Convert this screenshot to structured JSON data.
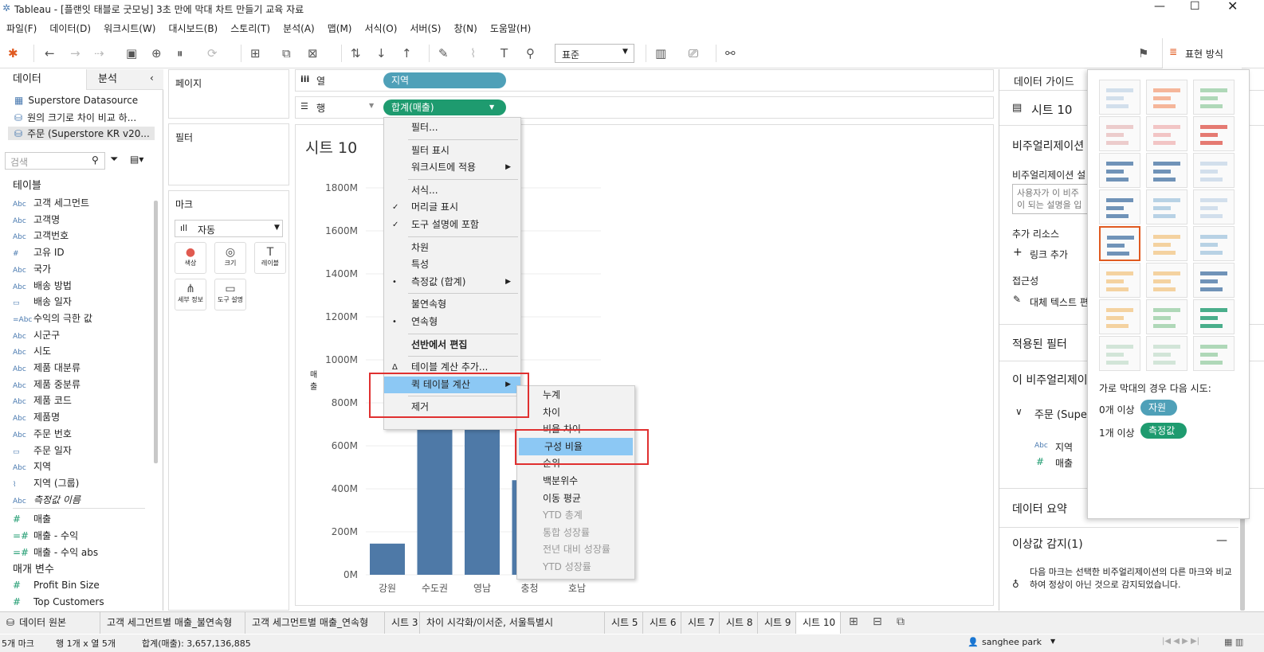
{
  "window": {
    "title": "Tableau - [플랜잇 태블로 굿모닝] 3초 만에 막대 차트 만들기 교육 자료"
  },
  "menubar": [
    "파일(F)",
    "데이터(D)",
    "워크시트(W)",
    "대시보드(B)",
    "스토리(T)",
    "분석(A)",
    "맵(M)",
    "서식(O)",
    "서버(S)",
    "창(N)",
    "도움말(H)"
  ],
  "toolbar": {
    "fit_value": "표준",
    "show_me_label": "표현 방식"
  },
  "left": {
    "tab_data": "데이터",
    "tab_analysis": "분석",
    "datasources": [
      "Superstore Datasource",
      "원의 크기로 차이 비교 하...",
      "주문 (Superstore KR v20..."
    ],
    "search_placeholder": "검색",
    "tables_header": "테이블",
    "dimensions": [
      {
        "type": "Abc",
        "name": "고객 세그먼트"
      },
      {
        "type": "Abc",
        "name": "고객명"
      },
      {
        "type": "Abc",
        "name": "고객번호"
      },
      {
        "type": "#",
        "name": "고유 ID"
      },
      {
        "type": "Abc",
        "name": "국가"
      },
      {
        "type": "Abc",
        "name": "배송 방법"
      },
      {
        "type": "date",
        "name": "배송 일자"
      },
      {
        "type": "=Abc",
        "name": "수익의 극한 값"
      },
      {
        "type": "Abc",
        "name": "시군구"
      },
      {
        "type": "Abc",
        "name": "시도"
      },
      {
        "type": "Abc",
        "name": "제품 대분류"
      },
      {
        "type": "Abc",
        "name": "제품 중분류"
      },
      {
        "type": "Abc",
        "name": "제품 코드"
      },
      {
        "type": "Abc",
        "name": "제품명"
      },
      {
        "type": "Abc",
        "name": "주문 번호"
      },
      {
        "type": "date",
        "name": "주문 일자"
      },
      {
        "type": "Abc",
        "name": "지역"
      },
      {
        "type": "clip",
        "name": "지역 (그룹)"
      },
      {
        "type": "Abc",
        "name": "측정값 이름"
      }
    ],
    "measures": [
      {
        "type": "#",
        "name": "매출"
      },
      {
        "type": "=#",
        "name": "매출 - 수익"
      },
      {
        "type": "=#",
        "name": "매출 - 수익 abs"
      }
    ],
    "params_header": "매개 변수",
    "params": [
      "Profit Bin Size",
      "Top Customers"
    ]
  },
  "cards": {
    "pages": "페이지",
    "filters": "필터",
    "marks": "마크",
    "mark_type": "자동",
    "mark_buttons": [
      "색상",
      "크기",
      "레이블",
      "세부 정보",
      "도구 설명"
    ]
  },
  "shelves": {
    "columns_label": "열",
    "rows_label": "행",
    "columns_pill": "지역",
    "rows_pill": "합계(매출)"
  },
  "sheet": {
    "title": "시트 10",
    "axis_label": "매출"
  },
  "chart_data": {
    "type": "bar",
    "categories": [
      "강원",
      "수도권",
      "영남",
      "충청",
      "호남"
    ],
    "values": [
      145000000,
      1500000000,
      1200000000,
      440000000,
      380000000
    ],
    "ylim": [
      0,
      1800000000
    ],
    "yticks": [
      "0M",
      "200M",
      "400M",
      "600M",
      "800M",
      "1000M",
      "1200M",
      "1400M",
      "1600M",
      "1800M"
    ],
    "color": "#4e79a7"
  },
  "context_menu": {
    "items": [
      {
        "label": "필터...",
        "check": "",
        "arrow": false,
        "bold": false
      },
      {
        "sep": true
      },
      {
        "label": "필터 표시",
        "check": "",
        "arrow": false
      },
      {
        "label": "워크시트에 적용",
        "check": "",
        "arrow": true
      },
      {
        "sep": true
      },
      {
        "label": "서식...",
        "check": "",
        "arrow": false
      },
      {
        "label": "머리글 표시",
        "check": "✓",
        "arrow": false
      },
      {
        "label": "도구 설명에 포함",
        "check": "✓",
        "arrow": false
      },
      {
        "sep": true
      },
      {
        "label": "차원",
        "check": "",
        "arrow": false
      },
      {
        "label": "특성",
        "check": "",
        "arrow": false
      },
      {
        "label": "측정값 (합계)",
        "check": "•",
        "arrow": true
      },
      {
        "sep": true
      },
      {
        "label": "불연속형",
        "check": "",
        "arrow": false
      },
      {
        "label": "연속형",
        "check": "•",
        "arrow": false
      },
      {
        "sep": true
      },
      {
        "label": "선반에서 편집",
        "check": "",
        "arrow": false,
        "bold": true
      },
      {
        "sep": true
      },
      {
        "label": "테이블 계산 추가...",
        "check": "Δ",
        "arrow": false
      },
      {
        "label": "퀵 테이블 계산",
        "check": "",
        "arrow": true,
        "hl": true
      },
      {
        "sep": true
      },
      {
        "label": "제거",
        "check": "",
        "arrow": false
      }
    ]
  },
  "submenu": {
    "items": [
      {
        "label": "누계",
        "dis": false
      },
      {
        "label": "차이",
        "dis": false
      },
      {
        "label": "비율 차이",
        "dis": false
      },
      {
        "label": "구성 비율",
        "dis": false,
        "hl": true
      },
      {
        "label": "순위",
        "dis": false
      },
      {
        "label": "백분위수",
        "dis": false
      },
      {
        "label": "이동 평균",
        "dis": false
      },
      {
        "label": "YTD 총계",
        "dis": true
      },
      {
        "label": "통합 성장률",
        "dis": true
      },
      {
        "label": "전년 대비 성장률",
        "dis": true
      },
      {
        "label": "YTD 성장률",
        "dis": true
      }
    ]
  },
  "right": {
    "guide_title": "데이터 가이드",
    "sheet_name": "시트 10",
    "viz_header": "비주얼리제이션",
    "viz_desc_label": "비주얼리제이션 설",
    "viz_desc_placeholder": "사용자가 이 비주\n이 되는 설명을 입",
    "extra_resources": "추가 리소스",
    "add_link": "링크 추가",
    "accessibility": "접근성",
    "alt_text": "대체 텍스트 편",
    "applied_filters": "적용된 필터",
    "this_viz": "이 비주얼리제이",
    "source_item": "주문 (Supe",
    "fields": [
      "지역",
      "매출"
    ],
    "data_summary": "데이터 요약",
    "outlier": "이상값 감지(1)",
    "outlier_desc": "다음 마크는 선택한 비주얼리제이션의 다른 마크와 비교하여 정상이 아닌 것으로 감지되었습니다."
  },
  "showme": {
    "hint": "가로 막대의 경우 다음 시도:",
    "req1_prefix": "0개 이상",
    "req1_pill": "자원",
    "req2_prefix": "1개 이상",
    "req2_pill": "측정값"
  },
  "bottom_tabs": [
    "데이터 원본",
    "고객 세그먼트별 매출_불연속형",
    "고객 세그먼트별 매출_연속형",
    "시트 3",
    "차이 시각화/이서준, 서울특별시",
    "시트 5",
    "시트 6",
    "시트 7",
    "시트 8",
    "시트 9",
    "시트 10"
  ],
  "status": {
    "marks": "5개 마크",
    "rows_cols": "행 1개 x 열 5개",
    "sum": "합계(매출): 3,657,136,885",
    "user": "sanghee park"
  }
}
